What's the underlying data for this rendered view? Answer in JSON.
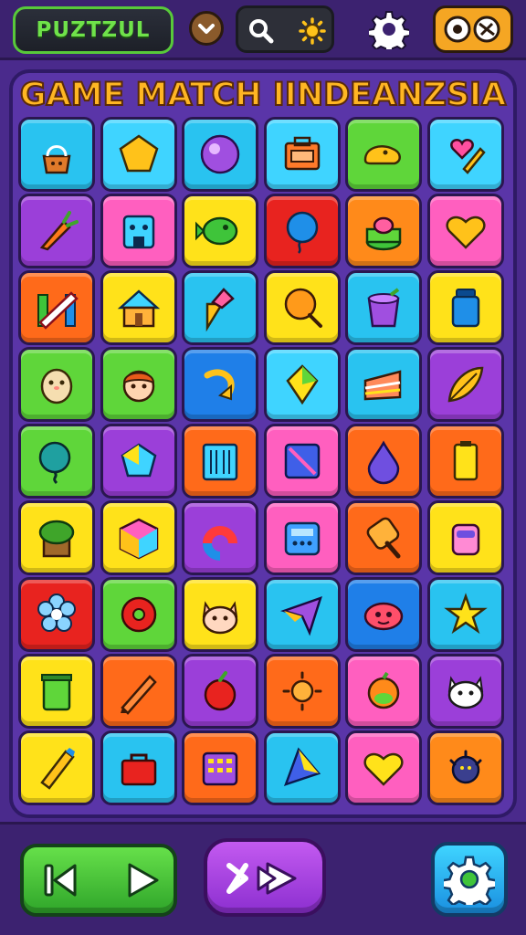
{
  "header": {
    "logo_text": "PUZTZUL",
    "icons": [
      "chevron-down-icon",
      "search-icon",
      "sun-icon",
      "gear-icon",
      "eye-toggle-icon"
    ]
  },
  "board": {
    "title": "GAME MATCH IINDEANZSIA",
    "columns": 6,
    "rows": 9,
    "tiles": [
      {
        "color": "#29c3f0",
        "icon": "bag"
      },
      {
        "color": "#3fd4ff",
        "icon": "pentagon"
      },
      {
        "color": "#29c3f0",
        "icon": "ball"
      },
      {
        "color": "#3fd4ff",
        "icon": "toolbox"
      },
      {
        "color": "#5fd63a",
        "icon": "blob"
      },
      {
        "color": "#3fd4ff",
        "icon": "heart-pop"
      },
      {
        "color": "#9b3fd9",
        "icon": "carrot"
      },
      {
        "color": "#ff5fbf",
        "icon": "robot"
      },
      {
        "color": "#ffe21a",
        "icon": "fish"
      },
      {
        "color": "#e8231f",
        "icon": "balloon"
      },
      {
        "color": "#ff8a1a",
        "icon": "cake"
      },
      {
        "color": "#ff5fbf",
        "icon": "heart"
      },
      {
        "color": "#ff6a1a",
        "icon": "sticks"
      },
      {
        "color": "#ffe21a",
        "icon": "house"
      },
      {
        "color": "#29c3f0",
        "icon": "ice-cream"
      },
      {
        "color": "#ffe21a",
        "icon": "lollipop"
      },
      {
        "color": "#29c3f0",
        "icon": "bucket"
      },
      {
        "color": "#ffe21a",
        "icon": "jar"
      },
      {
        "color": "#5fd63a",
        "icon": "hamster"
      },
      {
        "color": "#5fd63a",
        "icon": "kid"
      },
      {
        "color": "#1f7fe8",
        "icon": "arrow"
      },
      {
        "color": "#3fd4ff",
        "icon": "kite"
      },
      {
        "color": "#29c3f0",
        "icon": "cake-slice"
      },
      {
        "color": "#9b3fd9",
        "icon": "leaf"
      },
      {
        "color": "#5fd63a",
        "icon": "balloon-green"
      },
      {
        "color": "#9b3fd9",
        "icon": "gem"
      },
      {
        "color": "#ff6a1a",
        "icon": "book"
      },
      {
        "color": "#ff5fbf",
        "icon": "card"
      },
      {
        "color": "#ff6a1a",
        "icon": "drop"
      },
      {
        "color": "#ff6a1a",
        "icon": "battery"
      },
      {
        "color": "#ffe21a",
        "icon": "plant"
      },
      {
        "color": "#ffe21a",
        "icon": "cube"
      },
      {
        "color": "#9b3fd9",
        "icon": "magnet"
      },
      {
        "color": "#ff5fbf",
        "icon": "calculator"
      },
      {
        "color": "#ff6a1a",
        "icon": "popsicle"
      },
      {
        "color": "#ffe21a",
        "icon": "robot-pink"
      },
      {
        "color": "#e8231f",
        "icon": "flower"
      },
      {
        "color": "#5fd63a",
        "icon": "donut"
      },
      {
        "color": "#ffe21a",
        "icon": "cat"
      },
      {
        "color": "#29c3f0",
        "icon": "plane"
      },
      {
        "color": "#1f7fe8",
        "icon": "monster"
      },
      {
        "color": "#29c3f0",
        "icon": "star"
      },
      {
        "color": "#ffe21a",
        "icon": "can"
      },
      {
        "color": "#ff6a1a",
        "icon": "pencil"
      },
      {
        "color": "#9b3fd9",
        "icon": "apple"
      },
      {
        "color": "#ff6a1a",
        "icon": "sun"
      },
      {
        "color": "#ff5fbf",
        "icon": "orange"
      },
      {
        "color": "#9b3fd9",
        "icon": "white-cat"
      },
      {
        "color": "#ffe21a",
        "icon": "pen"
      },
      {
        "color": "#29c3f0",
        "icon": "lunchbox"
      },
      {
        "color": "#ff6a1a",
        "icon": "calc-orange"
      },
      {
        "color": "#29c3f0",
        "icon": "prism"
      },
      {
        "color": "#ff5fbf",
        "icon": "heart-yellow"
      },
      {
        "color": "#ff8a1a",
        "icon": "germ"
      }
    ]
  },
  "footer": {
    "icons": [
      "skip-back-icon",
      "play-icon",
      "shuffle-icon",
      "gear-icon"
    ]
  }
}
